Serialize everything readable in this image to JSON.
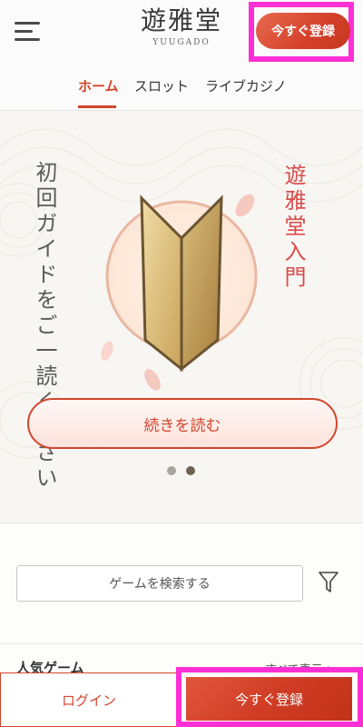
{
  "header": {
    "logo_kanji": "遊雅堂",
    "logo_roman": "YUUGADO",
    "register_label": "今すぐ登録",
    "menu_icon": "hamburger-menu-icon"
  },
  "nav": {
    "tabs": [
      {
        "label": "ホーム",
        "active": true
      },
      {
        "label": "スロット",
        "active": false
      },
      {
        "label": "ライブカジノ",
        "active": false
      }
    ]
  },
  "banner": {
    "left_text": "初回ガイドをご一読ください",
    "right_text": "遊雅堂入門",
    "emblem_icon": "beginner-mark-icon",
    "read_more_label": "続きを読む",
    "carousel": {
      "total": 2,
      "active_index": 1
    }
  },
  "games": {
    "search_placeholder": "ゲームを検索する",
    "filter_icon": "filter-funnel-icon",
    "popular_title": "人気ゲーム",
    "show_all_label": "すべて表示 >"
  },
  "bottom_bar": {
    "login_label": "ログイン",
    "register_label": "今すぐ登録"
  },
  "colors": {
    "accent": "#d3452d",
    "highlight_frame": "#ff2fd6",
    "text_dark": "#333333"
  }
}
